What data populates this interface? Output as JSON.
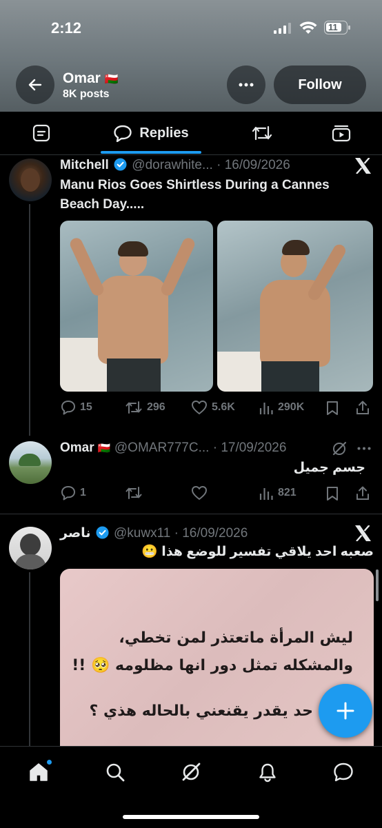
{
  "status_bar": {
    "time": "2:12",
    "battery": "11"
  },
  "profile": {
    "name": "Omar",
    "flag": "🇴🇲",
    "posts": "8K posts",
    "follow_label": "Follow"
  },
  "tabs": [
    {
      "icon": "article-icon",
      "label": ""
    },
    {
      "icon": "chat-bubble-icon",
      "label": "Replies",
      "selected": true
    },
    {
      "icon": "retweet-icon",
      "label": ""
    },
    {
      "icon": "video-icon",
      "label": ""
    }
  ],
  "tweets": [
    {
      "name": "Mitchell",
      "verified": true,
      "handle": "@dorawhite...",
      "date": "· 16/09/2026",
      "text_line1": "Manu Rios Goes Shirtless During a Cannes",
      "text_line2": "Beach Day.....",
      "source_icon": "x-logo-icon",
      "stats": {
        "replies": "15",
        "retweets": "296",
        "likes": "5.6K",
        "views": "290K"
      }
    },
    {
      "name": "Omar",
      "flag": "🇴🇲",
      "handle": "@OMAR777C...",
      "date": "· 17/09/2026",
      "text": "جسم جميل",
      "stats": {
        "replies": "1",
        "retweets": "",
        "likes": "",
        "views": "821"
      }
    },
    {
      "name": "ناصر",
      "verified": true,
      "handle": "@kuwx11",
      "date": "· 16/09/2026",
      "text": "صعبه احد يلاقي تفسير للوضع هذا 😬",
      "source_icon": "x-logo-icon",
      "image_text_line1": "ليش المرأة ماتعتذر لمن تخطي،",
      "image_text_line2": "والمشكله تمثل دور انها مظلومه 🥺 !!",
      "image_text_line3": "حد يقدر يقنعني بالحاله هذي ؟"
    }
  ],
  "colors": {
    "accent": "#1d9bf0",
    "muted": "#71767b",
    "background": "#000000"
  },
  "nav": [
    "home-icon",
    "search-icon",
    "grok-icon",
    "bell-icon",
    "messages-icon"
  ]
}
